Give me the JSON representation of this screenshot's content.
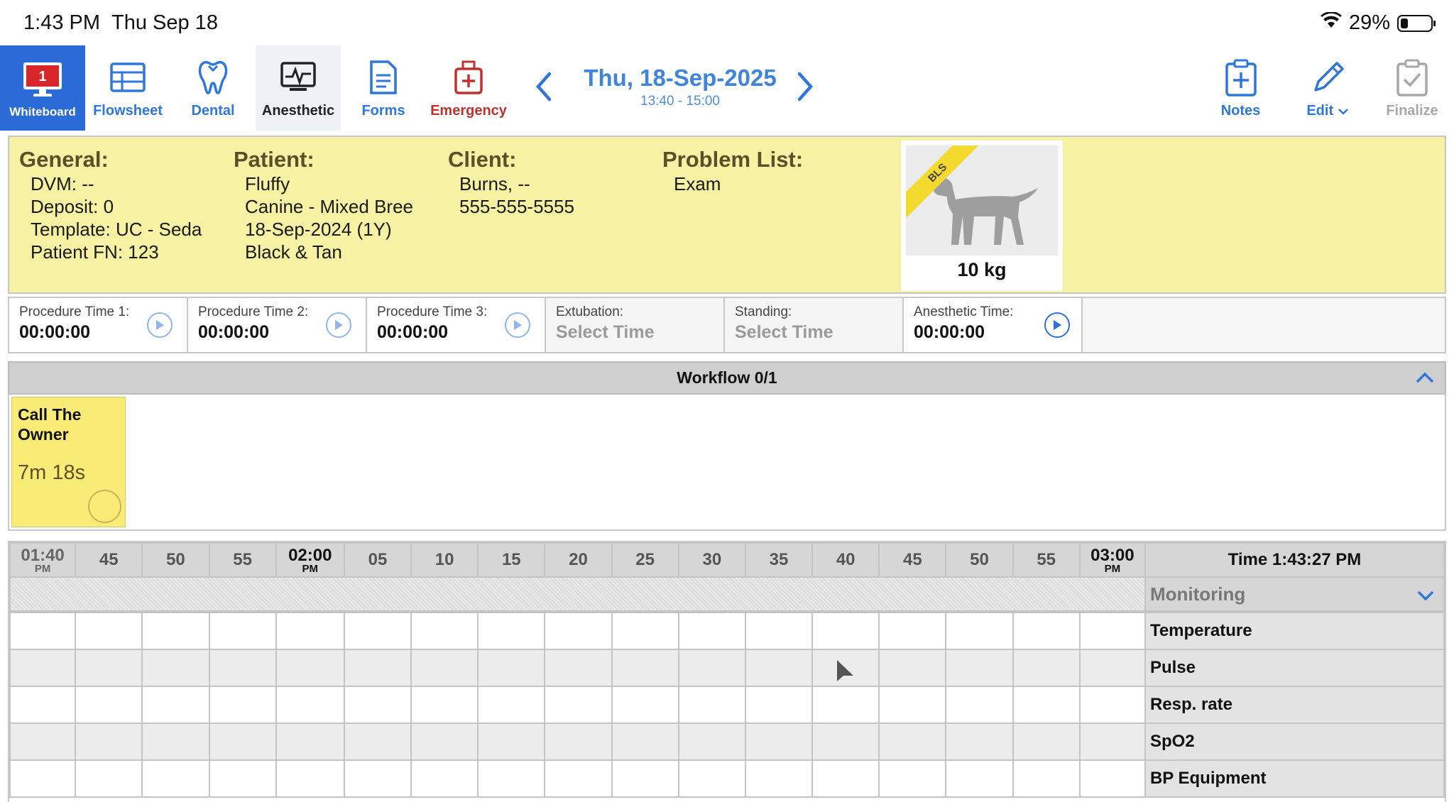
{
  "status_bar": {
    "time": "1:43 PM",
    "date": "Thu Sep 18",
    "battery": "29%"
  },
  "toolbar": {
    "tabs": [
      {
        "label": "Whiteboard",
        "badge": "1",
        "icon": "monitor-icon"
      },
      {
        "label": "Flowsheet",
        "icon": "table-icon"
      },
      {
        "label": "Dental",
        "icon": "tooth-icon"
      },
      {
        "label": "Anesthetic",
        "icon": "vitals-monitor-icon"
      },
      {
        "label": "Forms",
        "icon": "document-icon"
      },
      {
        "label": "Emergency",
        "icon": "medical-kit-icon"
      }
    ],
    "date_title": "Thu, 18-Sep-2025",
    "date_range": "13:40 - 15:00",
    "notes_label": "Notes",
    "edit_label": "Edit",
    "finalize_label": "Finalize"
  },
  "info": {
    "general": {
      "heading": "General:",
      "lines": [
        "DVM: --",
        "Deposit: 0",
        "Template: UC - Seda",
        "Patient FN: 123"
      ]
    },
    "patient": {
      "heading": "Patient:",
      "lines": [
        "Fluffy",
        "Canine - Mixed Bree",
        "18-Sep-2024 (1Y)",
        "Black & Tan"
      ]
    },
    "client": {
      "heading": "Client:",
      "lines": [
        "Burns, --",
        "555-555-5555"
      ]
    },
    "problems": {
      "heading": "Problem List:",
      "lines": [
        "Exam"
      ]
    },
    "pet_badge": "BLS",
    "weight": "10 kg"
  },
  "timers": [
    {
      "label": "Procedure Time 1:",
      "value": "00:00:00",
      "play": true
    },
    {
      "label": "Procedure Time 2:",
      "value": "00:00:00",
      "play": true
    },
    {
      "label": "Procedure Time 3:",
      "value": "00:00:00",
      "play": true
    },
    {
      "label": "Extubation:",
      "value": "Select Time",
      "play": false
    },
    {
      "label": "Standing:",
      "value": "Select Time",
      "play": false
    },
    {
      "label": "Anesthetic Time:",
      "value": "00:00:00",
      "play": true
    }
  ],
  "workflow": {
    "title": "Workflow 0/1",
    "task_title": "Call The Owner",
    "task_time": "7m 18s"
  },
  "grid": {
    "time_columns": [
      {
        "label": "01:40",
        "pm": "PM",
        "major": true
      },
      {
        "label": "45"
      },
      {
        "label": "50"
      },
      {
        "label": "55"
      },
      {
        "label": "02:00",
        "pm": "PM",
        "major": true
      },
      {
        "label": "05"
      },
      {
        "label": "10"
      },
      {
        "label": "15"
      },
      {
        "label": "20"
      },
      {
        "label": "25"
      },
      {
        "label": "30"
      },
      {
        "label": "35"
      },
      {
        "label": "40"
      },
      {
        "label": "45"
      },
      {
        "label": "50"
      },
      {
        "label": "55"
      },
      {
        "label": "03:00",
        "pm": "PM",
        "major": true
      }
    ],
    "clock": "Time 1:43:27 PM",
    "section": "Monitoring",
    "params": [
      "Temperature",
      "Pulse",
      "Resp. rate",
      "SpO2",
      "BP Equipment"
    ]
  }
}
